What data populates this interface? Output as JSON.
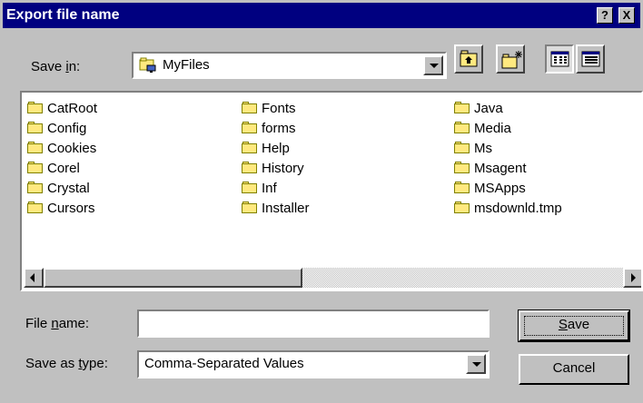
{
  "dialog": {
    "title": "Export file name",
    "help_glyph": "?",
    "close_glyph": "X"
  },
  "save_in": {
    "label_pre": "Save ",
    "label_key": "i",
    "label_post": "n:",
    "value": "MyFiles",
    "icon": "folder-network-icon"
  },
  "toolbar": {
    "up_icon": "up-one-level-icon",
    "new_folder_icon": "new-folder-icon",
    "list_icon": "list-view-icon",
    "details_icon": "details-view-icon"
  },
  "files": {
    "col1": [
      "CatRoot",
      "Config",
      "Cookies",
      "Corel",
      "Crystal",
      "Cursors"
    ],
    "col2": [
      "Fonts",
      "forms",
      "Help",
      "History",
      "Inf",
      "Installer"
    ],
    "col3": [
      "Java",
      "Media",
      "Ms",
      "Msagent",
      "MSApps",
      "msdownld.tmp"
    ]
  },
  "file_name": {
    "label_pre": "File ",
    "label_key": "n",
    "label_post": "ame:",
    "value": ""
  },
  "save_type": {
    "label_pre": "Save as ",
    "label_key": "t",
    "label_post": "ype:",
    "value": "Comma-Separated Values"
  },
  "buttons": {
    "save_key": "S",
    "save_rest": "ave",
    "cancel": "Cancel"
  },
  "colors": {
    "titlebar": "#000080",
    "face": "#c0c0c0",
    "folder": "#ffe97f"
  }
}
